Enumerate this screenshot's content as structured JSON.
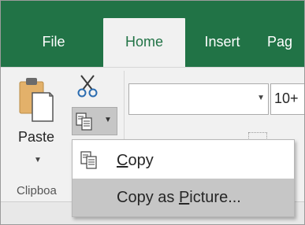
{
  "tabs": {
    "file": "File",
    "home": "Home",
    "insert": "Insert",
    "page": "Pag"
  },
  "ribbon": {
    "paste_label": "Paste",
    "clipboard_group_label": "Clipboa",
    "font_size_value": "10+"
  },
  "menu": {
    "copy_label_pre": "",
    "copy_label_ul": "C",
    "copy_label_post": "opy",
    "copy_picture_label_pre": "Copy as ",
    "copy_picture_label_ul": "P",
    "copy_picture_label_post": "icture..."
  },
  "colors": {
    "accent": "#217346",
    "hover": "#c6c6c6"
  },
  "icons": {
    "paste": "clipboard-paste-icon",
    "cut": "scissors-icon",
    "copy": "copy-icon"
  }
}
